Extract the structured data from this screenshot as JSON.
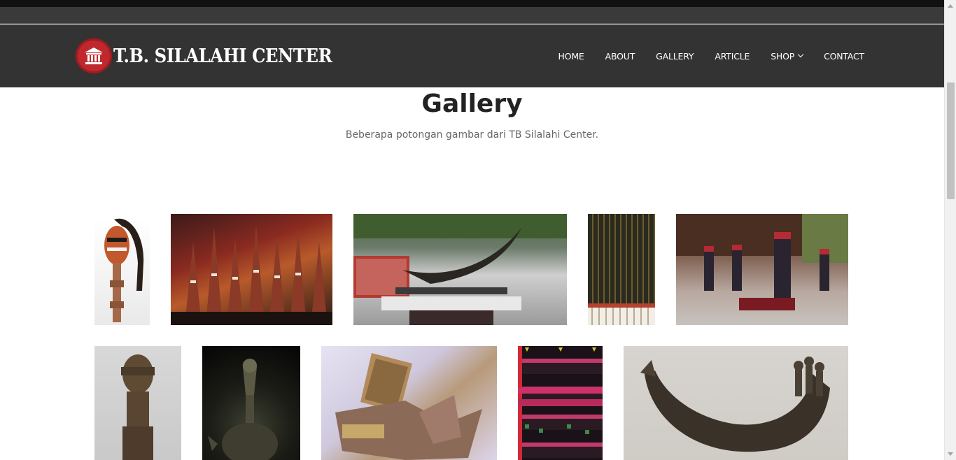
{
  "brand": {
    "name": "T.B. SILALAHI CENTER",
    "badge_color": "#c0282d"
  },
  "nav": {
    "items": [
      {
        "label": "HOME"
      },
      {
        "label": "ABOUT"
      },
      {
        "label": "GALLERY"
      },
      {
        "label": "ARTICLE"
      },
      {
        "label": "SHOP",
        "has_dropdown": true
      },
      {
        "label": "CONTACT"
      }
    ]
  },
  "page": {
    "title": "Gallery",
    "subtitle": "Beberapa potongan gambar dari TB Silalahi Center."
  },
  "gallery": {
    "images": [
      {
        "name": "gallery-image-mask-figure"
      },
      {
        "name": "gallery-image-carved-souvenirs"
      },
      {
        "name": "gallery-image-buffalo-horn-exhibit"
      },
      {
        "name": "gallery-image-striped-ulos"
      },
      {
        "name": "gallery-image-traditional-dancers"
      },
      {
        "name": "gallery-image-wooden-statue"
      },
      {
        "name": "gallery-image-bronze-vessel"
      },
      {
        "name": "gallery-image-folded-bark-book"
      },
      {
        "name": "gallery-image-pink-ulos"
      },
      {
        "name": "gallery-image-horn-container"
      }
    ]
  },
  "colors": {
    "header_bg": "#333333",
    "title_text": "#222222",
    "subtitle_text": "#666666"
  }
}
